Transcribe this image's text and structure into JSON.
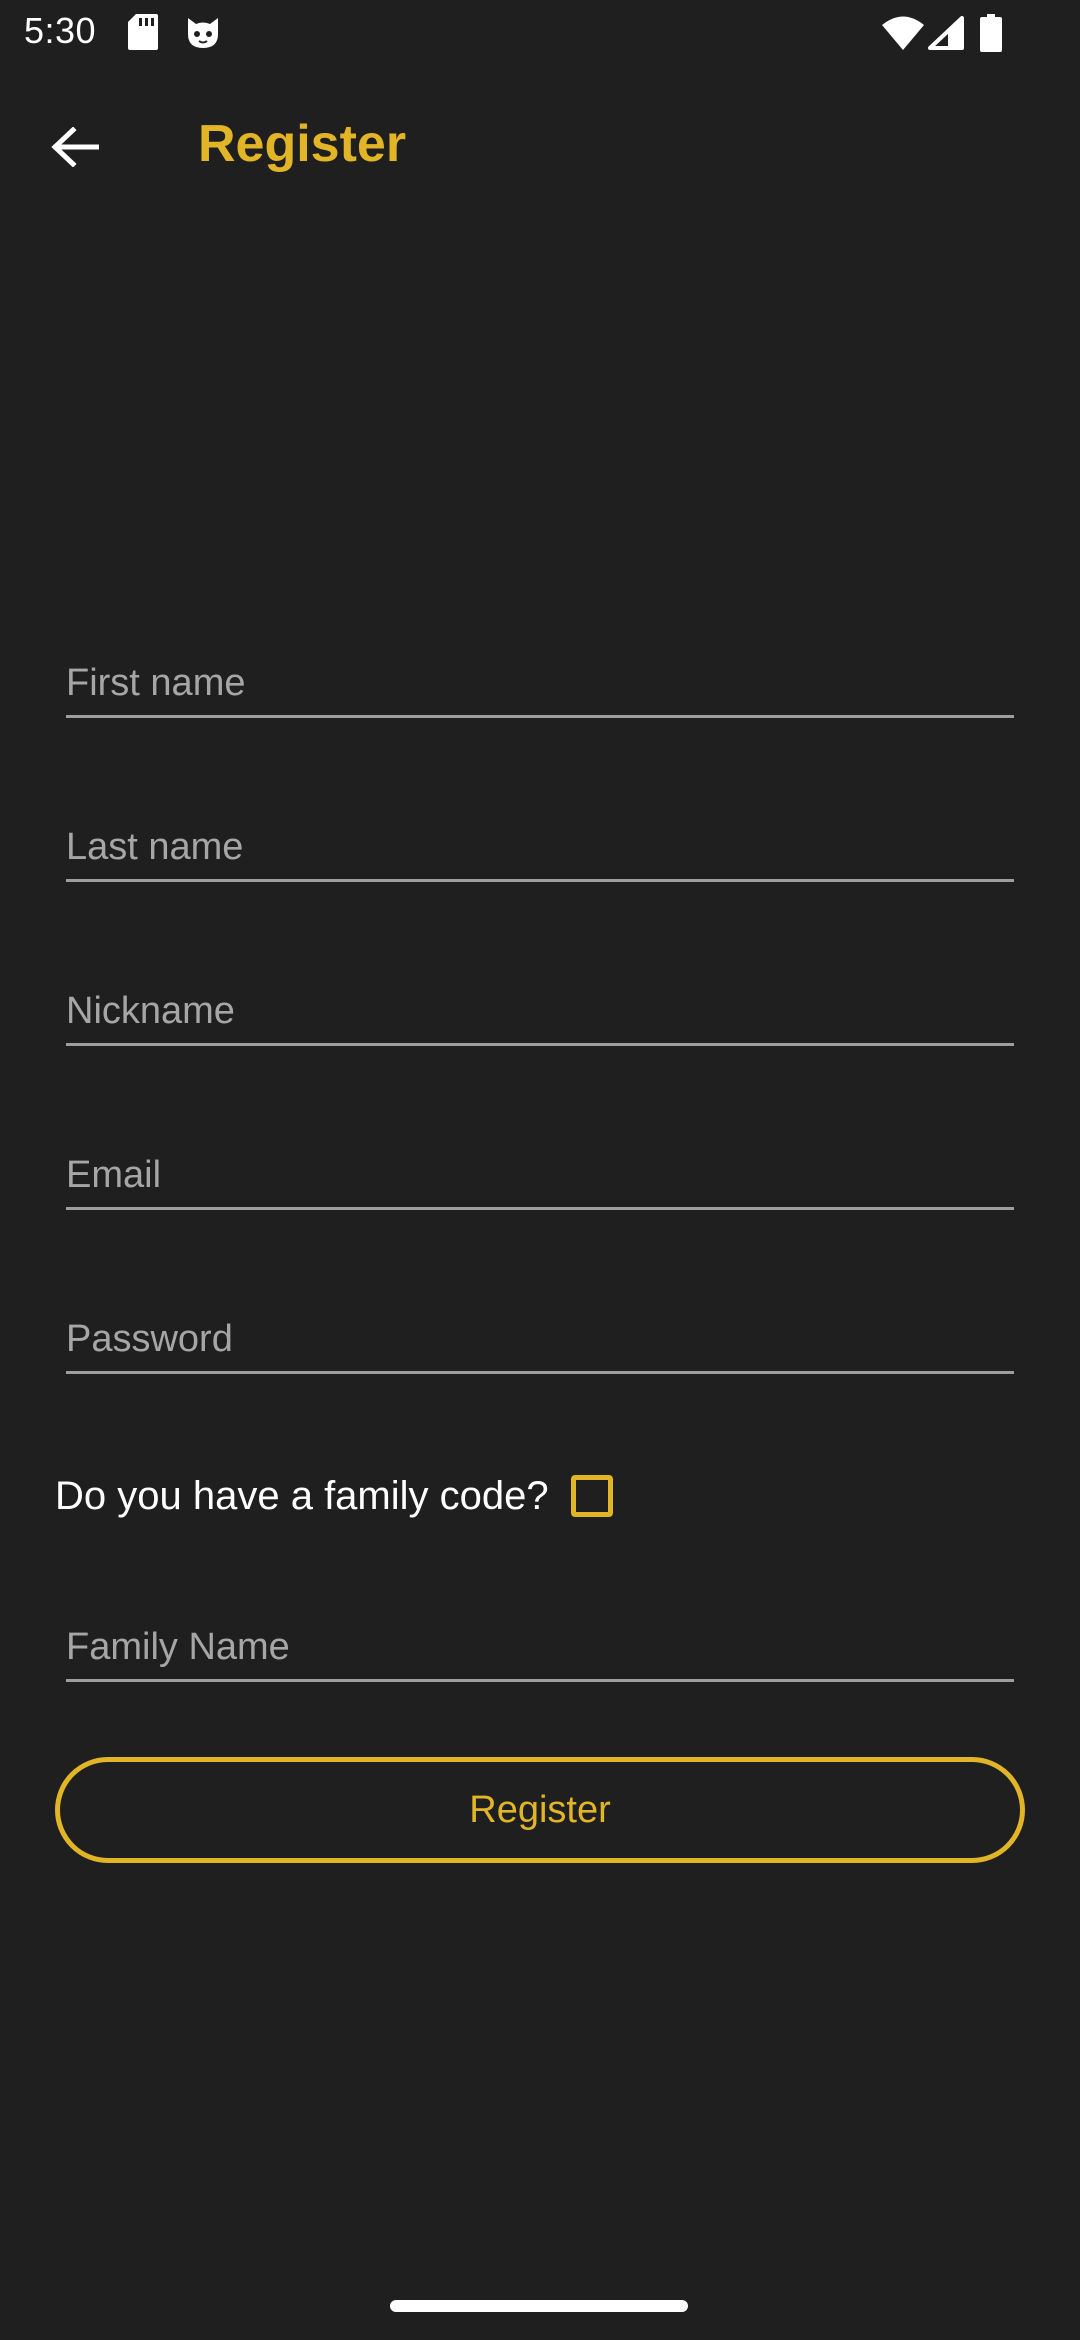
{
  "status_bar": {
    "time": "5:30",
    "icons_left": [
      "sd-card-icon",
      "cat-face-icon"
    ],
    "icons_right": [
      "wifi-icon",
      "signal-icon",
      "battery-icon"
    ]
  },
  "app_bar": {
    "back_icon": "arrow-back-icon",
    "title": "Register"
  },
  "form": {
    "first_name": {
      "placeholder": "First name",
      "value": ""
    },
    "last_name": {
      "placeholder": "Last name",
      "value": ""
    },
    "nickname": {
      "placeholder": "Nickname",
      "value": ""
    },
    "email": {
      "placeholder": "Email",
      "value": ""
    },
    "password": {
      "placeholder": "Password",
      "value": ""
    },
    "family_code_label": "Do you have a family code?",
    "family_code_checked": false,
    "family_name": {
      "placeholder": "Family Name",
      "value": ""
    },
    "register_label": "Register"
  },
  "colors": {
    "background": "#1f1f1f",
    "accent": "#e2b527",
    "text": "#ffffff",
    "hint": "#a6a6a6",
    "underline": "#9e9e9e"
  }
}
